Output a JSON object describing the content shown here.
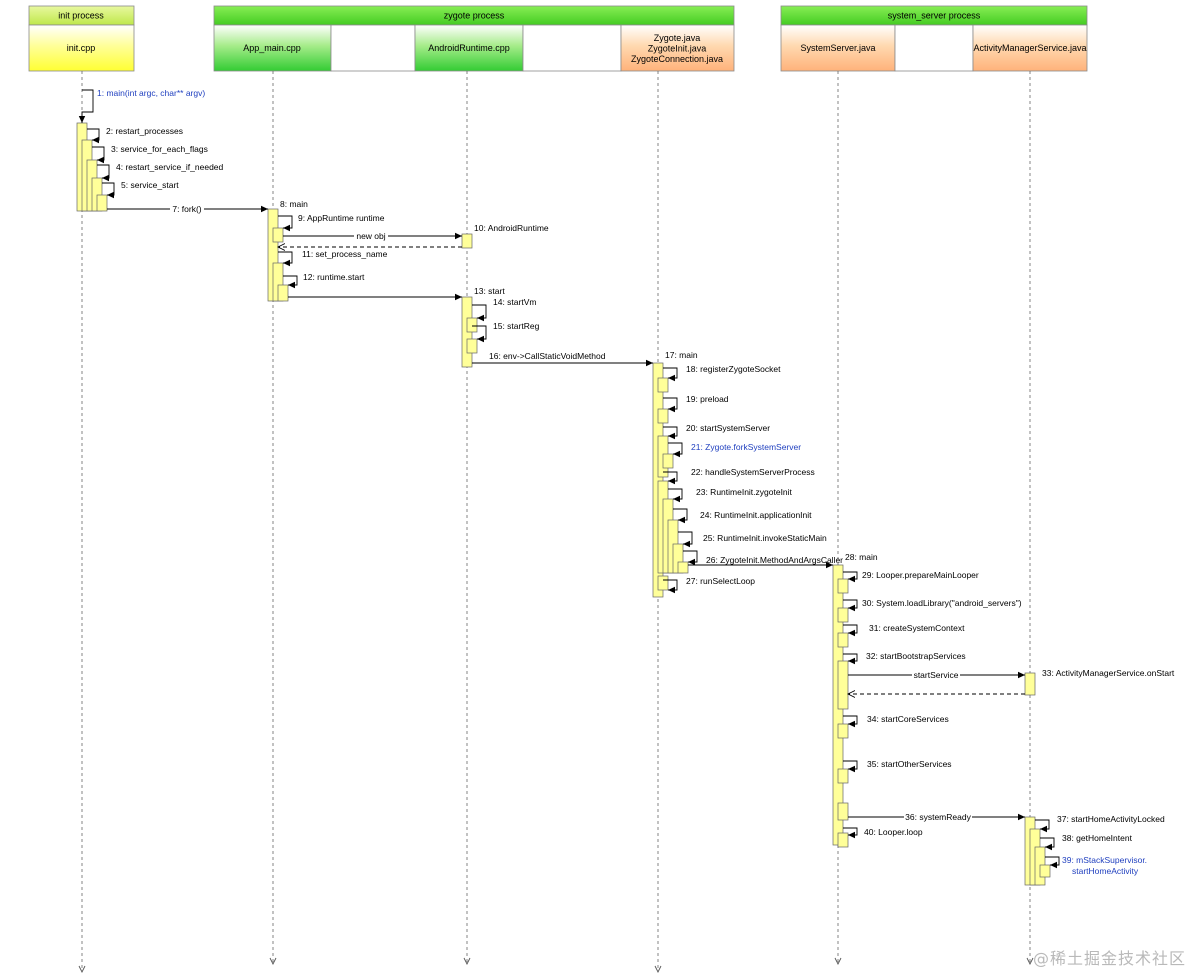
{
  "headers": {
    "init_process": "init process",
    "zygote_process": "zygote process",
    "system_server_process": "system_server process",
    "init_cpp": "init.cpp",
    "app_main_cpp": "App_main.cpp",
    "android_runtime_cpp": "AndroidRuntime.cpp",
    "zygote_files": [
      "Zygote.java",
      "ZygoteInit.java",
      "ZygoteConnection.java"
    ],
    "system_server_java": "SystemServer.java",
    "ams_java": "ActivityManagerService.java"
  },
  "messages": {
    "m1": "1: main(int argc, char** argv)",
    "m2": "2: restart_processes",
    "m3": "3: service_for_each_flags",
    "m4": "4: restart_service_if_needed",
    "m5": "5: service_start",
    "m7": "7: fork()",
    "m8": "8: main",
    "m9": "9: AppRuntime runtime",
    "new_obj": "new obj",
    "m10": "10: AndroidRuntime",
    "m11": "11: set_process_name",
    "m12": "12: runtime.start",
    "m13": "13: start",
    "m14": "14: startVm",
    "m15": "15: startReg",
    "m16": "16: env->CallStaticVoidMethod",
    "m17": "17: main",
    "m18": "18: registerZygoteSocket",
    "m19": "19: preload",
    "m20": "20: startSystemServer",
    "m21": "21: Zygote.forkSystemServer",
    "m22": "22: handleSystemServerProcess",
    "m23": "23: RuntimeInit.zygoteInit",
    "m24": "24: RuntimeInit.applicationInit",
    "m25": "25: RuntimeInit.invokeStaticMain",
    "m26": "26: ZygoteInit.MethodAndArgsCaller",
    "m27": "27: runSelectLoop",
    "m28": "28: main",
    "m29": "29: Looper.prepareMainLooper",
    "m30": "30: System.loadLibrary(\"android_servers\")",
    "m31": "31: createSystemContext",
    "m32": "32: startBootstrapServices",
    "start_service": "startService",
    "m33": "33: ActivityManagerService.onStart",
    "m34": "34: startCoreServices",
    "m35": "35: startOtherServices",
    "m36": "36: systemReady",
    "m37": "37: startHomeActivityLocked",
    "m38": "38: getHomeIntent",
    "m39": [
      "39: mStackSupervisor.",
      "startHomeActivity"
    ],
    "m40": "40: Looper.loop"
  },
  "watermark": "@稀土掘金技术社区",
  "colors": {
    "init_header": "#ccee66",
    "init_box": "#ffff66",
    "zygote_header": "#66dd33",
    "java_box": "#ffcc99",
    "activation": "#ffff99",
    "highlight_text": "#1f3fbf"
  }
}
